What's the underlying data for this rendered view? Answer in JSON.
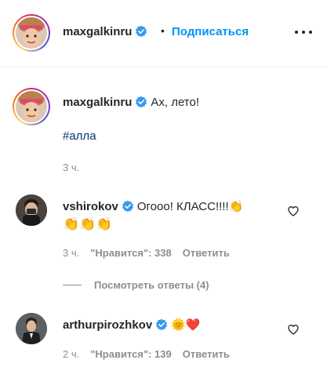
{
  "header": {
    "username": "maxgalkinru",
    "dot": "•",
    "follow_label": "Подписаться"
  },
  "caption": {
    "username": "maxgalkinru",
    "text": "Ах, лето!",
    "hashtag": "#алла",
    "time": "3 ч."
  },
  "comments": [
    {
      "username": "vshirokov",
      "text": "Огооо! КЛАСС!!!!",
      "emoji_line1": "👏",
      "emoji_line2": "👏👏👏",
      "time": "3 ч.",
      "likes": "\"Нравится\": 338",
      "reply_label": "Ответить"
    },
    {
      "username": "arthurpirozhkov",
      "emojis": "🌞❤️",
      "time": "2 ч.",
      "likes": "\"Нравится\": 139",
      "reply_label": "Ответить"
    }
  ],
  "view_replies_label": "Посмотреть ответы (4)",
  "colors": {
    "link_blue": "#0095f6",
    "hashtag": "#00376b",
    "secondary_text": "#8e8e8e",
    "verified": "#3897f0"
  },
  "icons": [
    "verified-badge-icon",
    "more-options-icon",
    "heart-icon"
  ]
}
